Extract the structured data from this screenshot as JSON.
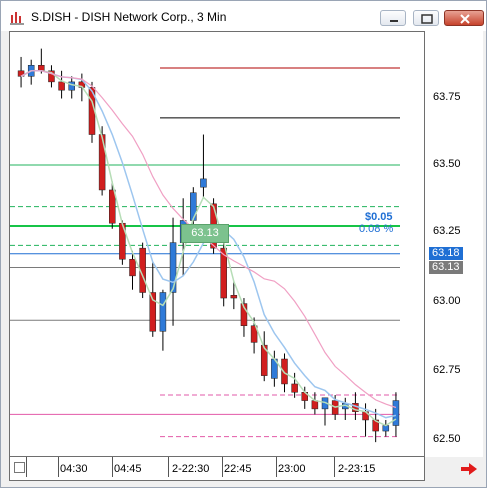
{
  "window": {
    "title": "S.DISH - DISH Network Corp., 3 Min",
    "icon": "chart-app-icon",
    "controls": [
      "minimize-icon",
      "restore-icon",
      "close-icon"
    ]
  },
  "chart_data": {
    "type": "candlestick",
    "y_ticks": [
      "63.75",
      "63.50",
      "63.25",
      "63.00",
      "62.75",
      "62.50"
    ],
    "ylim": [
      62.45,
      63.98
    ],
    "x_labels": [
      "04:30",
      "04:45",
      "2-22:30",
      "22:45",
      "23:00",
      "2-23:15"
    ],
    "grid": false,
    "candles": [
      {
        "o": 63.84,
        "h": 63.89,
        "l": 63.78,
        "c": 63.82
      },
      {
        "o": 63.82,
        "h": 63.88,
        "l": 63.79,
        "c": 63.86
      },
      {
        "o": 63.86,
        "h": 63.92,
        "l": 63.83,
        "c": 63.84
      },
      {
        "o": 63.84,
        "h": 63.86,
        "l": 63.78,
        "c": 63.8
      },
      {
        "o": 63.8,
        "h": 63.84,
        "l": 63.74,
        "c": 63.77
      },
      {
        "o": 63.77,
        "h": 63.82,
        "l": 63.74,
        "c": 63.8
      },
      {
        "o": 63.8,
        "h": 63.83,
        "l": 63.73,
        "c": 63.78
      },
      {
        "o": 63.78,
        "h": 63.8,
        "l": 63.58,
        "c": 63.61
      },
      {
        "o": 63.61,
        "h": 63.64,
        "l": 63.39,
        "c": 63.41
      },
      {
        "o": 63.41,
        "h": 63.44,
        "l": 63.27,
        "c": 63.29
      },
      {
        "o": 63.29,
        "h": 63.3,
        "l": 63.14,
        "c": 63.16
      },
      {
        "o": 63.16,
        "h": 63.19,
        "l": 63.05,
        "c": 63.1
      },
      {
        "o": 63.2,
        "h": 63.22,
        "l": 63.02,
        "c": 63.04
      },
      {
        "o": 63.04,
        "h": 63.15,
        "l": 62.88,
        "c": 62.9
      },
      {
        "o": 62.9,
        "h": 63.05,
        "l": 62.83,
        "c": 63.04
      },
      {
        "o": 63.04,
        "h": 63.31,
        "l": 62.92,
        "c": 63.22
      },
      {
        "o": 63.22,
        "h": 63.38,
        "l": 63.1,
        "c": 63.3
      },
      {
        "o": 63.3,
        "h": 63.42,
        "l": 63.24,
        "c": 63.4
      },
      {
        "o": 63.42,
        "h": 63.61,
        "l": 63.38,
        "c": 63.45
      },
      {
        "o": 63.36,
        "h": 63.38,
        "l": 63.18,
        "c": 63.2
      },
      {
        "o": 63.2,
        "h": 63.22,
        "l": 62.99,
        "c": 63.02
      },
      {
        "o": 63.03,
        "h": 63.08,
        "l": 62.98,
        "c": 63.02
      },
      {
        "o": 63.0,
        "h": 63.02,
        "l": 62.88,
        "c": 62.92
      },
      {
        "o": 62.92,
        "h": 62.95,
        "l": 62.82,
        "c": 62.86
      },
      {
        "o": 62.85,
        "h": 62.9,
        "l": 62.72,
        "c": 62.74
      },
      {
        "o": 62.73,
        "h": 62.83,
        "l": 62.7,
        "c": 62.8
      },
      {
        "o": 62.8,
        "h": 62.82,
        "l": 62.68,
        "c": 62.71
      },
      {
        "o": 62.71,
        "h": 62.75,
        "l": 62.66,
        "c": 62.68
      },
      {
        "o": 62.68,
        "h": 62.7,
        "l": 62.62,
        "c": 62.65
      },
      {
        "o": 62.65,
        "h": 62.68,
        "l": 62.6,
        "c": 62.62
      },
      {
        "o": 62.62,
        "h": 62.66,
        "l": 62.56,
        "c": 62.66
      },
      {
        "o": 62.65,
        "h": 62.67,
        "l": 62.58,
        "c": 62.6
      },
      {
        "o": 62.62,
        "h": 62.66,
        "l": 62.58,
        "c": 62.64
      },
      {
        "o": 62.64,
        "h": 62.68,
        "l": 62.58,
        "c": 62.61
      },
      {
        "o": 62.61,
        "h": 62.64,
        "l": 62.52,
        "c": 62.58
      },
      {
        "o": 62.58,
        "h": 62.62,
        "l": 62.5,
        "c": 62.54
      },
      {
        "o": 62.54,
        "h": 62.58,
        "l": 62.52,
        "c": 62.56
      },
      {
        "o": 62.56,
        "h": 62.68,
        "l": 62.52,
        "c": 62.65
      }
    ],
    "hlines": [
      {
        "price": 63.85,
        "color": "#b00000",
        "style": "solid"
      },
      {
        "price": 63.67,
        "color": "#000000",
        "style": "solid"
      },
      {
        "price": 63.5,
        "color": "#21b35c",
        "style": "solid"
      },
      {
        "price": 63.35,
        "color": "#21b35c",
        "style": "dashed"
      },
      {
        "price": 63.28,
        "color": "#16c447",
        "style": "solid"
      },
      {
        "price": 63.21,
        "color": "#21b35c",
        "style": "dashed"
      },
      {
        "price": 63.18,
        "color": "#1f6fd4",
        "style": "solid"
      },
      {
        "price": 63.13,
        "color": "#7a7a7a",
        "style": "solid"
      },
      {
        "price": 62.94,
        "color": "#7a7a7a",
        "style": "solid"
      },
      {
        "price": 62.67,
        "color": "#e25aa8",
        "style": "dashed"
      },
      {
        "price": 62.6,
        "color": "#e25aa8",
        "style": "solid"
      },
      {
        "price": 62.52,
        "color": "#e25aa8",
        "style": "dashed"
      }
    ],
    "labels": {
      "change": "$0.05",
      "change_pct": "0.08 %",
      "last_price": "63.18",
      "bid_price": "63.13",
      "marker_price": "63.13"
    },
    "colors": {
      "up": "#2f7ad8",
      "down": "#d11e1e",
      "ma_fast": "#9dc6ef",
      "ma_slow": "#f0a0c4",
      "ma_green": "#b6ddb6"
    }
  }
}
